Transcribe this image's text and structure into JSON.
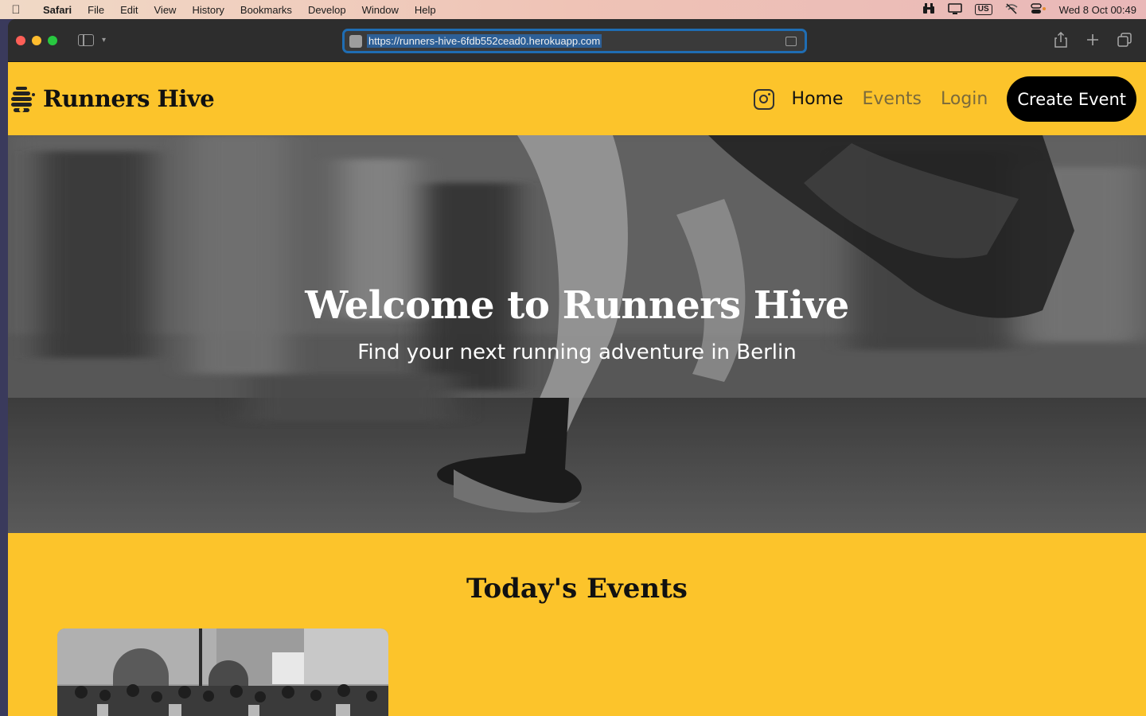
{
  "menubar": {
    "app_name": "Safari",
    "items": [
      "File",
      "Edit",
      "View",
      "History",
      "Bookmarks",
      "Develop",
      "Window",
      "Help"
    ],
    "keyboard_layout": "US",
    "clock": "Wed 8 Oct  00:49"
  },
  "browser": {
    "url": "https://runners-hive-6fdb552cead0.herokuapp.com"
  },
  "site": {
    "brand": "Runners Hive",
    "nav": {
      "home": "Home",
      "events": "Events",
      "login": "Login",
      "cta": "Create Event"
    },
    "hero": {
      "title": "Welcome to Runners Hive",
      "subtitle": "Find your next running adventure in Berlin"
    },
    "section_title": "Today's Events"
  },
  "colors": {
    "brand_yellow": "#fcc42b",
    "cta_black": "#000000",
    "url_focus": "#1f6db3"
  }
}
